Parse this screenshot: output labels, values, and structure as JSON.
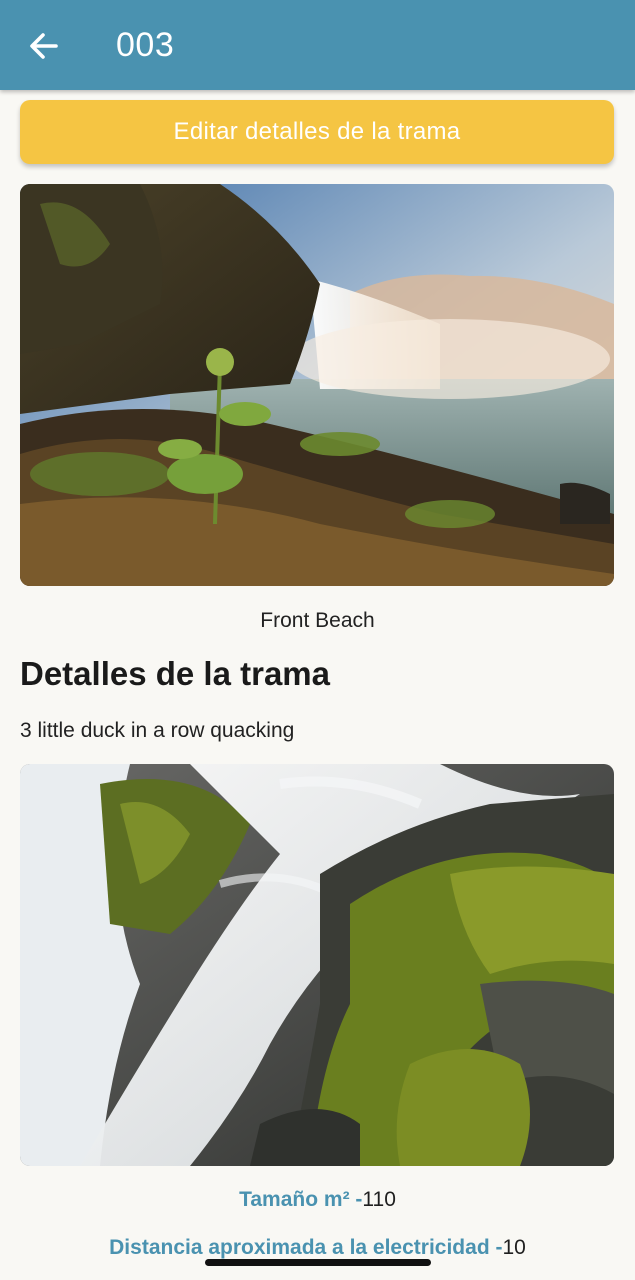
{
  "appbar": {
    "title": "003",
    "back_icon": "arrow-left-icon",
    "background": "#4a92b0"
  },
  "edit_button": {
    "label": "Editar detalles de la trama",
    "color": "#f5c543"
  },
  "plot": {
    "caption": "Front Beach",
    "section_title": "Detalles de la trama",
    "description": "3 little duck in a row quacking",
    "size": {
      "label": "Tamaño m² -",
      "value": "110"
    },
    "electricity": {
      "label": "Distancia aproximada a la electricidad -",
      "value": "10"
    }
  },
  "accent_color": "#4a92b0"
}
